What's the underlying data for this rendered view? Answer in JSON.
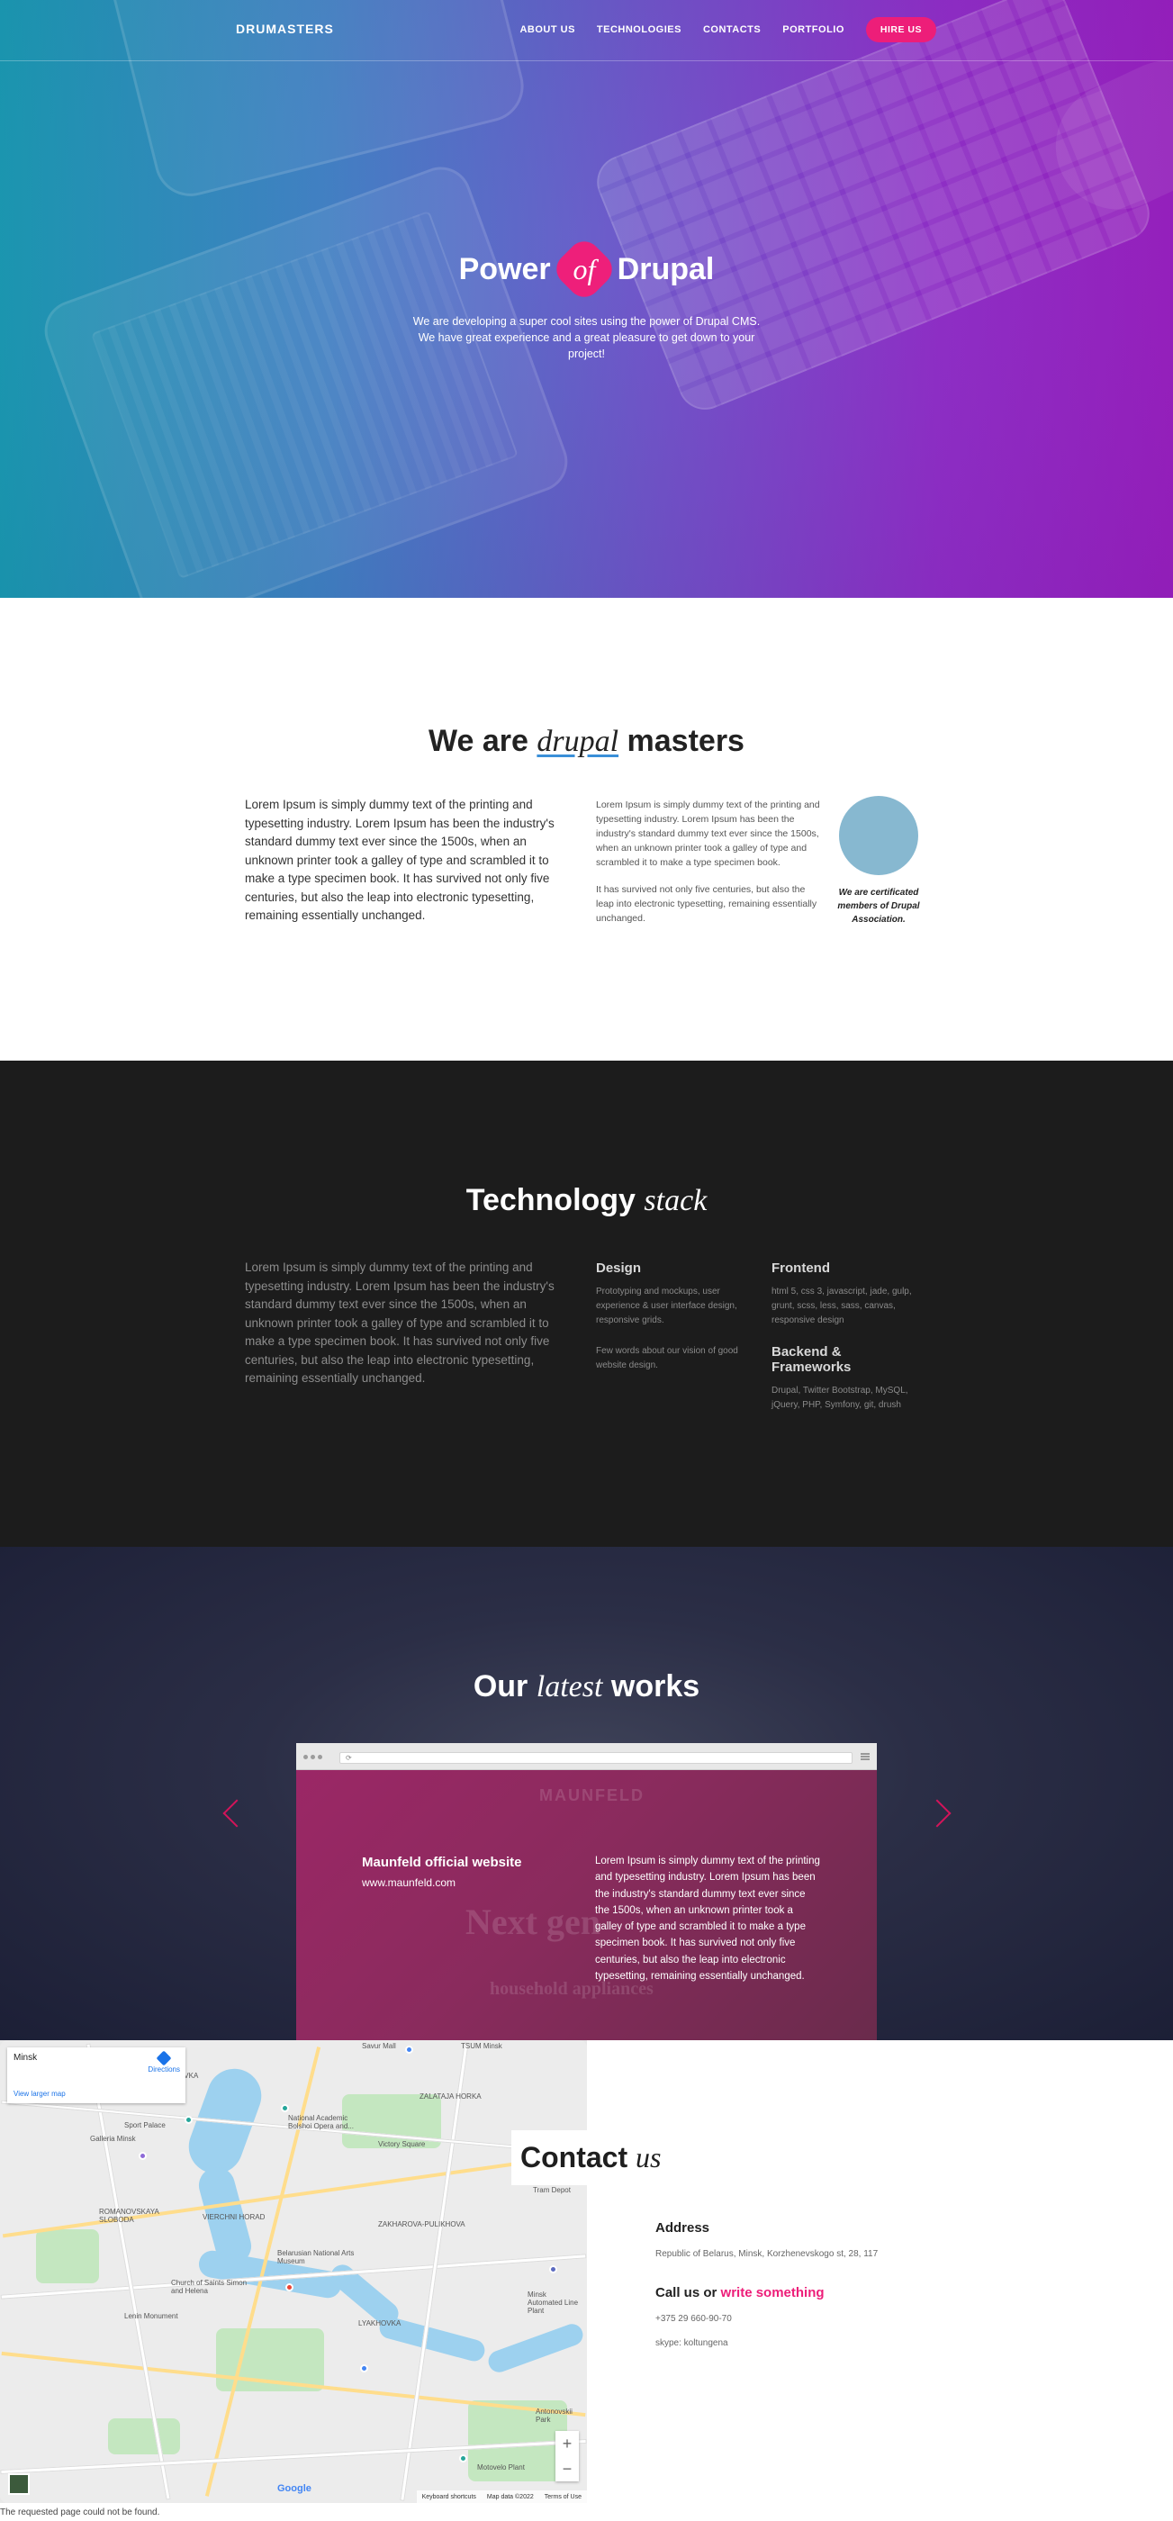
{
  "nav": {
    "logo": "DRUMASTERS",
    "items": [
      "ABOUT US",
      "TECHNOLOGIES",
      "CONTACTS",
      "PORTFOLIO"
    ],
    "hire": "HIRE US"
  },
  "hero": {
    "title_pre": "Power",
    "title_of": "of",
    "title_post": "Drupal",
    "subtitle": "We are developing a super cool sites using the power of Drupal CMS. We have great experience and a great pleasure to get down to your project!"
  },
  "about": {
    "title_pre": "We are",
    "title_em": "drupal",
    "title_post": "masters",
    "lead": "Lorem Ipsum is simply dummy text of the printing and typesetting industry. Lorem Ipsum has been the industry's standard dummy text ever since the 1500s, when an unknown printer took a galley of type and scrambled it to make a type specimen book. It has survived not only five centuries, but also the leap into electronic typesetting, remaining essentially unchanged.",
    "p1": "Lorem Ipsum is simply dummy text of the printing and typesetting industry. Lorem Ipsum has been the industry's standard dummy text ever since the 1500s, when an unknown printer took a galley of type and scrambled it to make a type specimen book.",
    "p2": "It has survived not only five centuries, but also the leap into electronic typesetting, remaining essentially unchanged.",
    "cert": "We are certificated members of Drupal Association."
  },
  "tech": {
    "title_pre": "Technology",
    "title_em": "stack",
    "lead": "Lorem Ipsum is simply dummy text of the printing and typesetting industry. Lorem Ipsum has been the industry's standard dummy text ever since the 1500s, when an unknown printer took a galley of type and scrambled it to make a type specimen book. It has survived not only five centuries, but also the leap into electronic typesetting, remaining essentially unchanged.",
    "design_h": "Design",
    "design_p1": "Prototyping and mockups, user experience & user interface design, responsive grids.",
    "design_p2": "Few words about our vision of good website design.",
    "frontend_h": "Frontend",
    "frontend_p": "html 5, css 3, javascript, jade, gulp, grunt, scss, less, sass, canvas, responsive design",
    "backend_h": "Backend & Frameworks",
    "backend_p": "Drupal, Twitter Bootstrap, MySQL, jQuery, PHP, Symfony, git, drush"
  },
  "works": {
    "title_pre": "Our",
    "title_em": "latest",
    "title_post": "works",
    "project_name": "Maunfeld official website",
    "project_url": "www.maunfeld.com",
    "project_desc": "Lorem Ipsum is simply dummy text of the printing and typesetting industry. Lorem Ipsum has been the industry's standard dummy text ever since the 1500s, when an unknown printer took a galley of type and scrambled it to make a type specimen book. It has survived not only five centuries, but also the leap into electronic typesetting, remaining essentially unchanged.",
    "shot_logo": "MAUNFELD",
    "shot_heading": "Next gen",
    "shot_sub": "household appliances"
  },
  "map": {
    "place": "Minsk",
    "directions": "Directions",
    "larger": "View larger map",
    "labels": [
      "Sport Palace",
      "Galleria Minsk",
      "National Academic Bolshoi Opera and...",
      "Victory Square",
      "ROMANOVSKAYA SLOBODA",
      "VIERCHNI HORAD",
      "ZAKHAROVA-PULIKHOVA",
      "LYAKHOVKA",
      "Belarusian National Arts Museum",
      "Church of Saints Simon and Helena",
      "Lenin Monument",
      "Tram Depot",
      "Minsk Automated Line Plant",
      "Motovelo Plant",
      "Antonovskii Park",
      "Savur Mall",
      "TSUM Minsk",
      "ZALATAJA HORKA",
      "STOROZHEVKA"
    ],
    "keyboard": "Keyboard shortcuts",
    "mapdata": "Map data ©2022",
    "terms": "Terms of Use",
    "google": "Google"
  },
  "contact": {
    "title_pre": "Contact",
    "title_em": "us",
    "address_h": "Address",
    "address": "Republic of Belarus, Minsk, Korzhenevskogo st, 28, 117",
    "call_pre": "Call us or",
    "call_link": "write something",
    "phone": "+375 29 660-90-70",
    "skype": "skype: koltungena"
  },
  "error": "The requested page could not be found.",
  "colors": {
    "accent": "#ed1e79",
    "dark": "#1c1c1c",
    "works_bg": "#2b2e46"
  }
}
